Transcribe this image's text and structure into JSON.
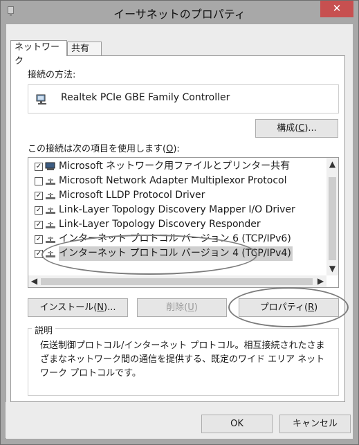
{
  "window": {
    "title": "イーサネットのプロパティ",
    "close_glyph": "✕"
  },
  "tabs": [
    {
      "label": "ネットワーク"
    },
    {
      "label": "共有"
    }
  ],
  "connect_using": {
    "label": "接続の方法:",
    "adapter": "Realtek PCIe GBE Family Controller"
  },
  "configure_button": {
    "label": "構成(",
    "accel": "C",
    "suffix": ")..."
  },
  "items_label": {
    "text": "この接続は次の項目を使用します(",
    "accel": "O",
    "suffix": "):"
  },
  "items": [
    {
      "label": "Microsoft ネットワーク用ファイルとプリンター共有",
      "checked": true,
      "icon": "share-icon"
    },
    {
      "label": "Microsoft Network Adapter Multiplexor Protocol",
      "checked": false,
      "icon": "protocol-icon"
    },
    {
      "label": "Microsoft LLDP Protocol Driver",
      "checked": true,
      "icon": "protocol-icon"
    },
    {
      "label": "Link-Layer Topology Discovery Mapper I/O Driver",
      "checked": true,
      "icon": "protocol-icon"
    },
    {
      "label": "Link-Layer Topology Discovery Responder",
      "checked": true,
      "icon": "protocol-icon"
    },
    {
      "label": "インターネット プロトコル バージョン 6 (TCP/IPv6)",
      "checked": true,
      "icon": "protocol-icon"
    },
    {
      "label": "インターネット プロトコル バージョン 4 (TCP/IPv4)",
      "checked": true,
      "icon": "protocol-icon",
      "selected": true
    }
  ],
  "buttons": {
    "install": {
      "label": "インストール(",
      "accel": "N",
      "suffix": ")..."
    },
    "remove": {
      "label": "削除(",
      "accel": "U",
      "suffix": ")"
    },
    "properties": {
      "label": "プロパティ(",
      "accel": "R",
      "suffix": ")"
    },
    "ok": {
      "label": "OK"
    },
    "cancel": {
      "label": "キャンセル"
    }
  },
  "description": {
    "title": "説明",
    "text": "伝送制御プロトコル/インターネット プロトコル。相互接続されたさまざまなネットワーク間の通信を提供する、既定のワイド エリア ネットワーク プロトコルです。"
  },
  "colors": {
    "titlebar": "#a8a8a8",
    "close": "#c75050",
    "selection": "#cfcfcf",
    "annotation": "#7c7c7c"
  }
}
